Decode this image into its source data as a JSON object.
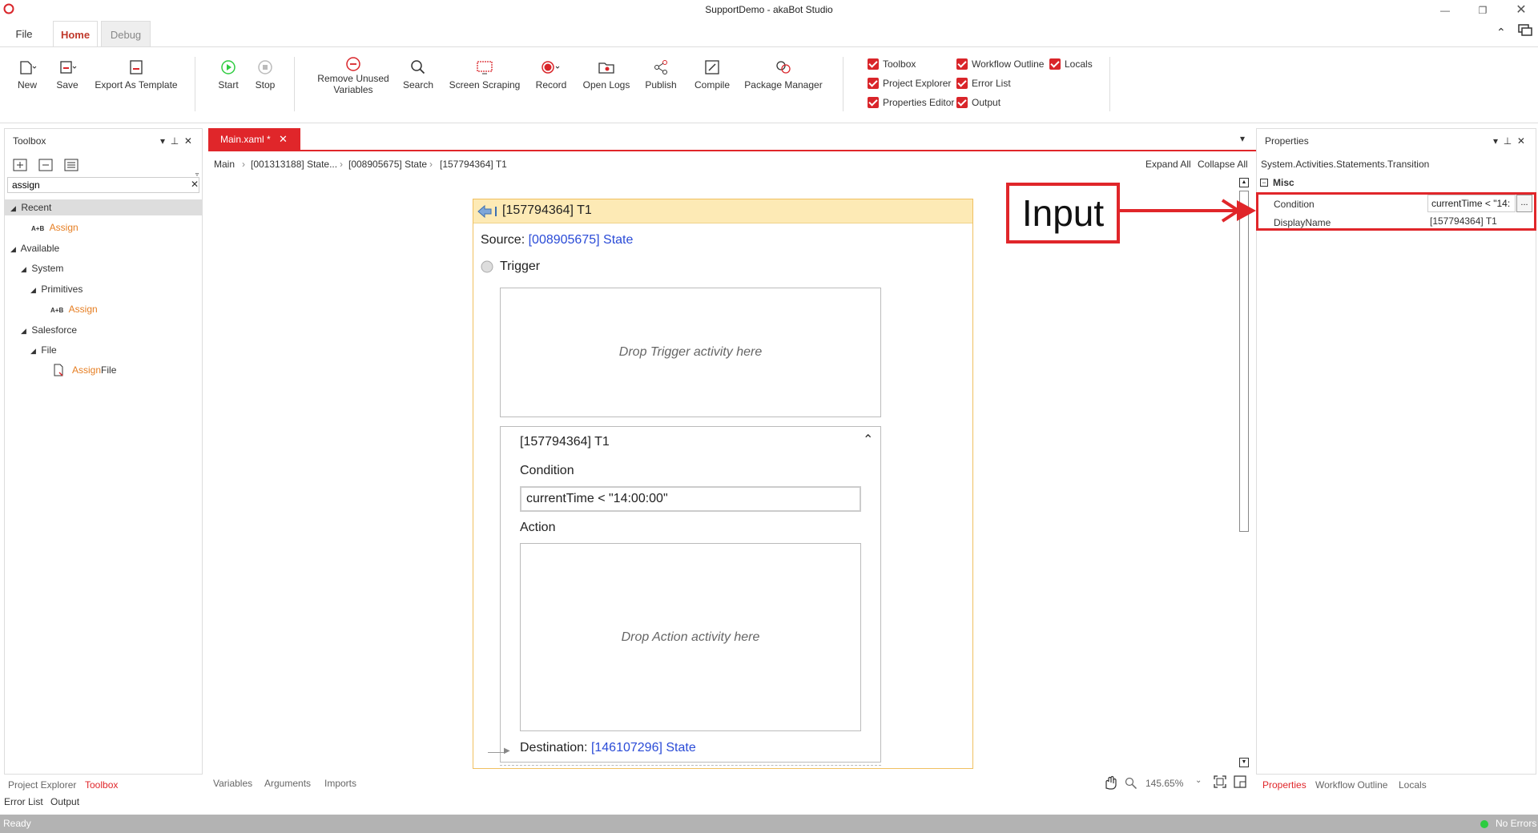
{
  "window": {
    "title": "SupportDemo - akaBot Studio"
  },
  "ribbon_tabs": {
    "file": "File",
    "home": "Home",
    "debug": "Debug"
  },
  "ribbon": {
    "new": "New",
    "save": "Save",
    "export_template": "Export As Template",
    "start": "Start",
    "stop": "Stop",
    "remove_unused_1": "Remove Unused",
    "remove_unused_2": "Variables",
    "search": "Search",
    "screen_scraping": "Screen Scraping",
    "record": "Record",
    "open_logs": "Open Logs",
    "publish": "Publish",
    "compile": "Compile",
    "package_manager": "Package Manager"
  },
  "panel_toggles": {
    "toolbox": "Toolbox",
    "project_explorer": "Project Explorer",
    "properties_editor": "Properties Editor",
    "workflow_outline": "Workflow Outline",
    "error_list": "Error List",
    "output": "Output",
    "locals": "Locals"
  },
  "toolbox": {
    "title": "Toolbox",
    "search_value": "assign",
    "recent": "Recent",
    "assign": "Assign",
    "available": "Available",
    "system": "System",
    "primitives": "Primitives",
    "salesforce": "Salesforce",
    "file": "File",
    "assign_file_prefix": "Assign",
    "assign_file_suffix": " File",
    "ab_icon": "A+B"
  },
  "document": {
    "tab_label": "Main.xaml *",
    "breadcrumbs": [
      "Main",
      "[001313188] State...",
      "[008905675] State",
      "[157794364] T1"
    ],
    "expand_all": "Expand All",
    "collapse_all": "Collapse All"
  },
  "transition": {
    "header": "[157794364] T1",
    "source_label": "Source: ",
    "source_link": "[008905675] State",
    "trigger_label": "Trigger",
    "drop_trigger": "Drop Trigger activity here",
    "inner_title": "[157794364] T1",
    "condition_label": "Condition",
    "condition_value": "currentTime < \"14:00:00\"",
    "action_label": "Action",
    "drop_action": "Drop Action activity here",
    "destination_label": "Destination: ",
    "destination_link": "[146107296] State"
  },
  "properties": {
    "title": "Properties",
    "type_name": "System.Activities.Statements.Transition",
    "section": "Misc",
    "condition_label": "Condition",
    "condition_value": "currentTime < \"14:",
    "displayname_label": "DisplayName",
    "displayname_value": "[157794364] T1",
    "ellipsis": "..."
  },
  "annotation": {
    "text": "Input"
  },
  "bottom": {
    "project_explorer": "Project Explorer",
    "toolbox": "Toolbox",
    "error_list": "Error List",
    "output": "Output",
    "variables": "Variables",
    "arguments": "Arguments",
    "imports": "Imports",
    "zoom": "145.65%",
    "properties": "Properties",
    "workflow_outline": "Workflow Outline",
    "locals": "Locals"
  },
  "status": {
    "left": "Ready",
    "right": "No Errors"
  },
  "colors": {
    "accent": "#e0262a",
    "link": "#2a4bd7",
    "orange": "#e67e22",
    "ok": "#2ecc40"
  }
}
